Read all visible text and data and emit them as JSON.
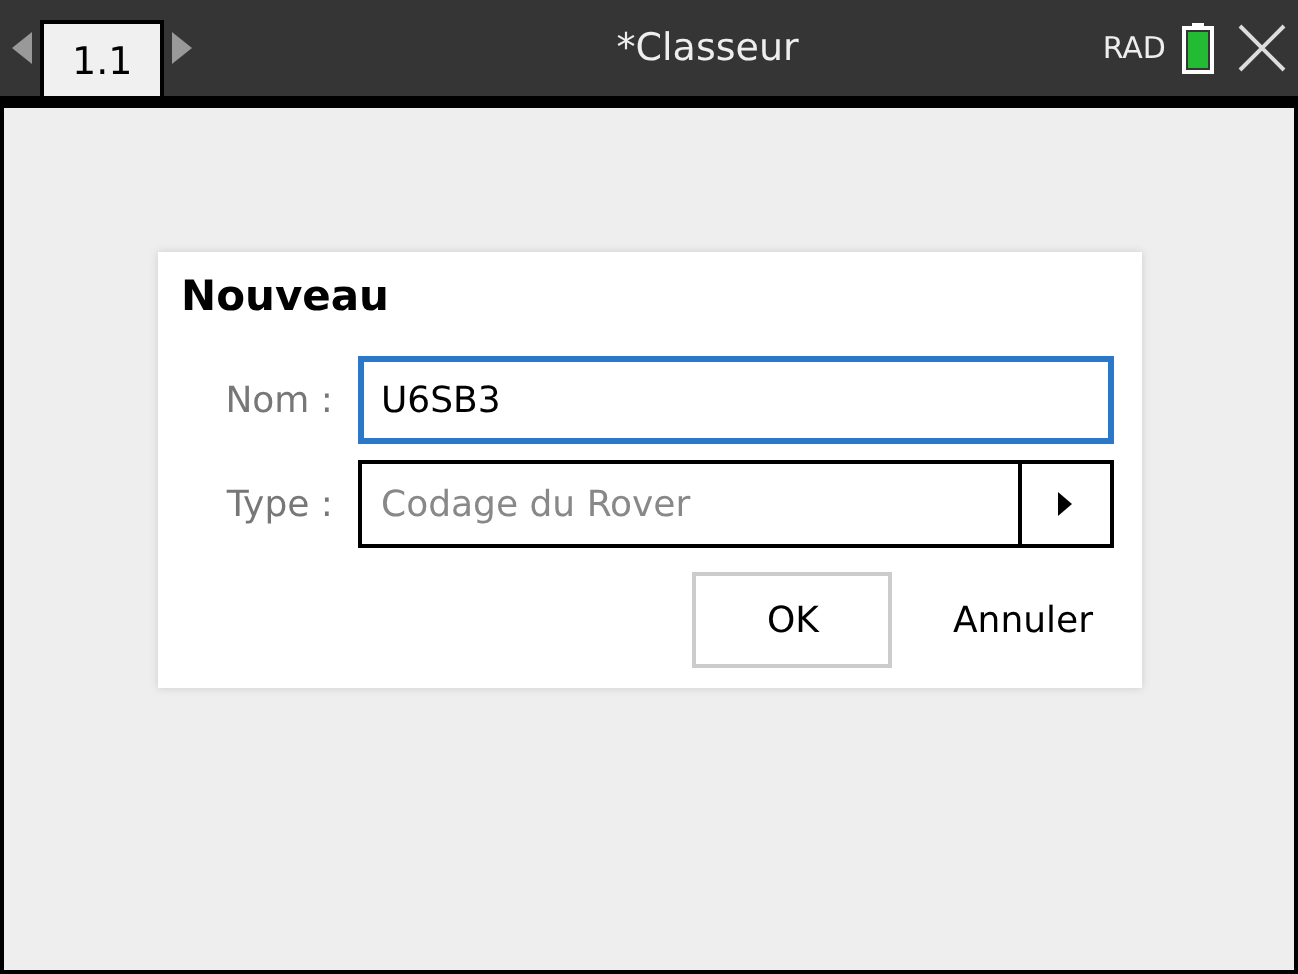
{
  "tabs": [
    {
      "label": "1.1",
      "selected": true
    }
  ],
  "window": {
    "title": "*Classeur"
  },
  "status": {
    "angle_mode": "RAD"
  },
  "dialog": {
    "title": "Nouveau",
    "fields": [
      {
        "kind": "text",
        "label": "Nom :",
        "value": "U6SB3",
        "focused": true
      },
      {
        "kind": "dropdown",
        "label": "Type :",
        "value": "Codage du Rover",
        "focused": false
      }
    ],
    "buttons": [
      {
        "label": "OK",
        "default": true
      },
      {
        "label": "Annuler",
        "default": false
      }
    ]
  }
}
